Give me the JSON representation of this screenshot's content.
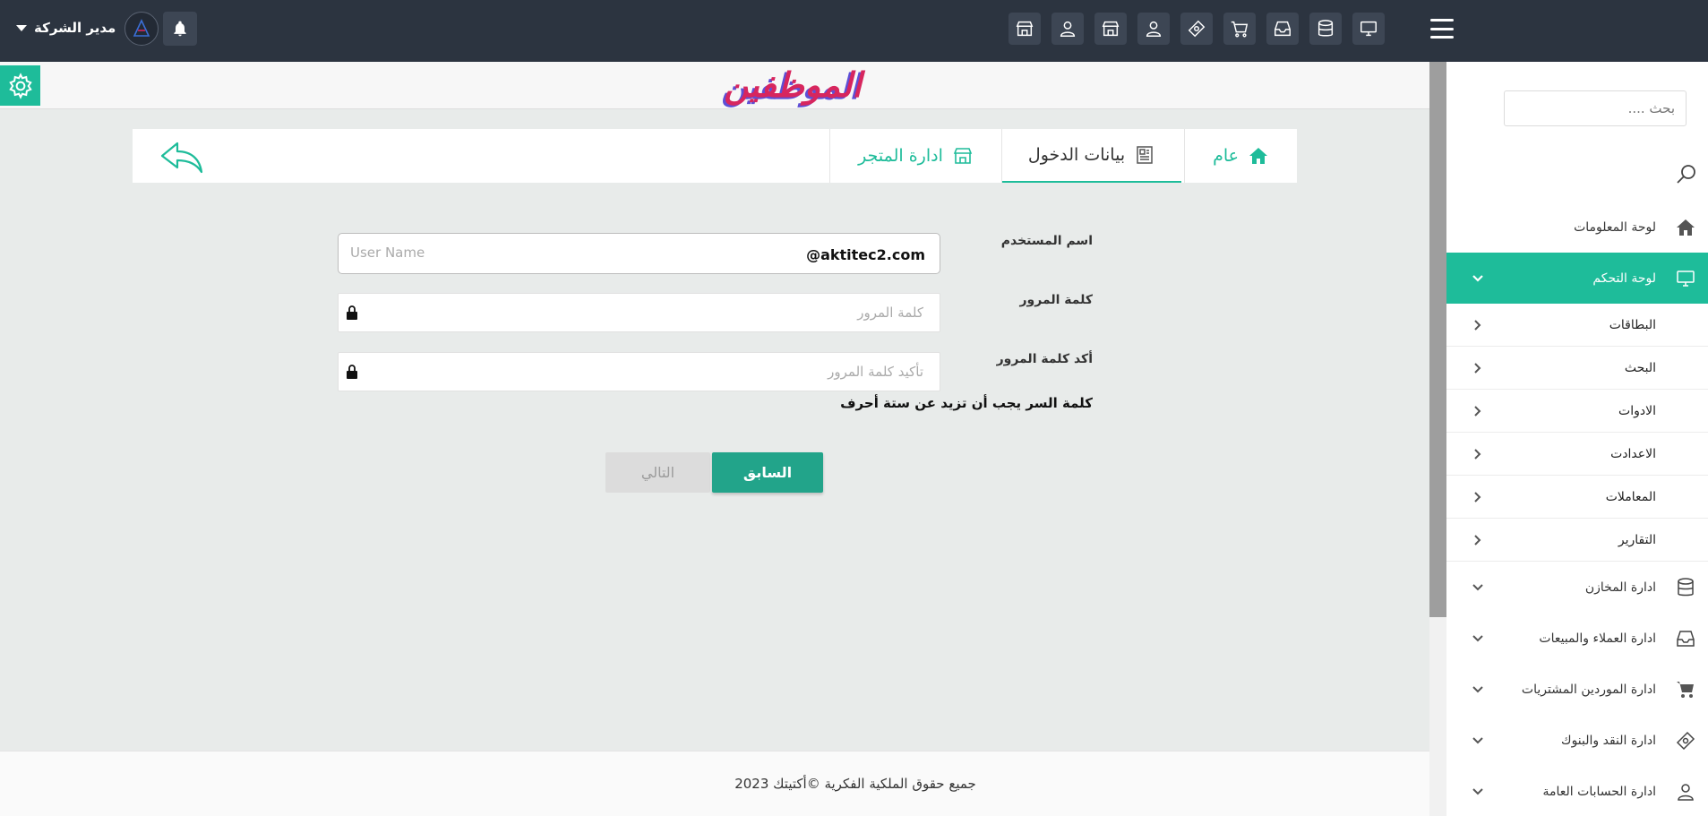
{
  "topbar": {
    "user_label": "مدير الشركة",
    "icons": [
      "store-icon",
      "user-icon",
      "store-icon",
      "user-icon",
      "money-icon",
      "cart-icon",
      "inbox-icon",
      "database-icon",
      "monitor-icon"
    ]
  },
  "page": {
    "title": "الموظفين"
  },
  "tabs": {
    "general": "عام",
    "login": "بيانات الدخول",
    "store": "ادارة المتجر"
  },
  "form": {
    "username_label": "اسم المستخدم",
    "username_placeholder": "User Name",
    "username_suffix": "@aktitec2.com",
    "password_label": "كلمة المرور",
    "password_placeholder": "كلمة المرور",
    "confirm_label": "أكد كلمة المرور",
    "confirm_placeholder": "تأكيد كلمة المرور",
    "hint": "كلمة السر يجب أن تزيد عن ستة أحرف",
    "prev_button": "السابق",
    "next_button": "التالي"
  },
  "sidebar": {
    "search_placeholder": "بحث ....",
    "items": [
      {
        "label": "لوحة المعلومات",
        "icon": "home-icon"
      },
      {
        "label": "لوحة التحكم",
        "icon": "monitor-icon",
        "active": true
      },
      {
        "label": "ادارة المخازن",
        "icon": "database-icon"
      },
      {
        "label": "ادارة العملاء والمبيعات",
        "icon": "inbox-icon"
      },
      {
        "label": "ادارة الموردين المشتريات",
        "icon": "cart-icon"
      },
      {
        "label": "ادارة النقد والبنوك",
        "icon": "money-icon"
      },
      {
        "label": "ادارة الحسابات العامة",
        "icon": "user-icon"
      }
    ],
    "sub_items": [
      "البطاقات",
      "البحث",
      "الادوات",
      "الاعدادت",
      "المعاملات",
      "التقارير"
    ]
  },
  "footer": {
    "text": "جميع حقوق الملكية الفكرية ©أكتيتك 2023"
  },
  "colors": {
    "accent": "#1ebc9a",
    "topbar": "#2c3440",
    "button": "#22a48a"
  }
}
